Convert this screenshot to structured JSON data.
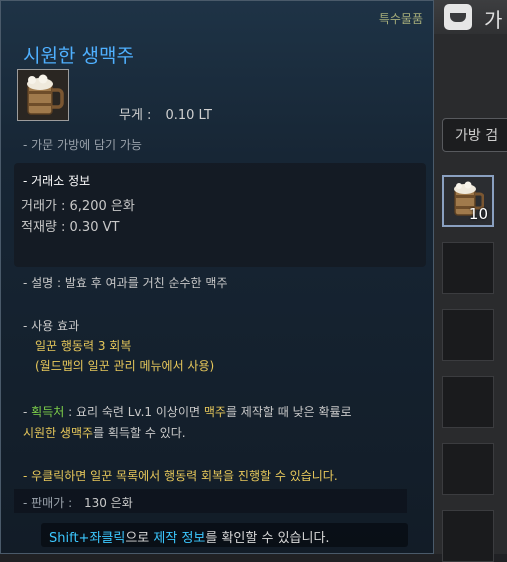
{
  "inventory": {
    "title": "가",
    "search_placeholder": "가방 검",
    "slots": [
      {
        "count": "10",
        "icon": "beer-mug-icon"
      },
      {
        "count": ""
      },
      {
        "count": ""
      },
      {
        "count": ""
      },
      {
        "count": ""
      },
      {
        "count": ""
      }
    ]
  },
  "tooltip": {
    "grade": "특수물품",
    "name": "시원한 생맥주",
    "icon": "beer-mug-icon",
    "weight_label": "무게 :",
    "weight_value": "0.10 LT",
    "storage_note": "- 가문 가방에 담기 가능",
    "market": {
      "heading": "- 거래소 정보",
      "price": "거래가 : 6,200 은화",
      "stock": "적재량 : 0.30 VT"
    },
    "description": "- 설명 : 발효 후 여과를 거친 순수한 맥주",
    "use_effect": {
      "heading": "- 사용 효과",
      "line1": "일꾼 행동력 3 회복",
      "line2": "(월드맵의 일꾼 관리 메뉴에서 사용)"
    },
    "acquire": {
      "label": "획득처",
      "prefix": "- ",
      "sep": " : ",
      "text_a": "요리 숙련 Lv.1 이상이면 ",
      "highlight1": "맥주",
      "text_b": "를 제작할 때 낮은 확률로",
      "highlight2": "시원한 생맥주",
      "text_c": "를 획득할 수 있다."
    },
    "right_click": "- 우클릭하면 일꾼 목록에서 행동력 회복을 진행할 수 있습니다.",
    "sell_label": "- 판매가 :",
    "sell_value": "130 은화",
    "footer": {
      "key": "Shift+좌클릭",
      "text_a": "으로 ",
      "link": "제작 정보",
      "text_b": "를 확인할 수 있습니다."
    }
  },
  "colors": {
    "title_blue": "#4fb0ff",
    "yellow": "#e7c85b",
    "green": "#7ed04a",
    "cyan": "#3cc8ff",
    "grade_text": "#a6ad7a"
  }
}
